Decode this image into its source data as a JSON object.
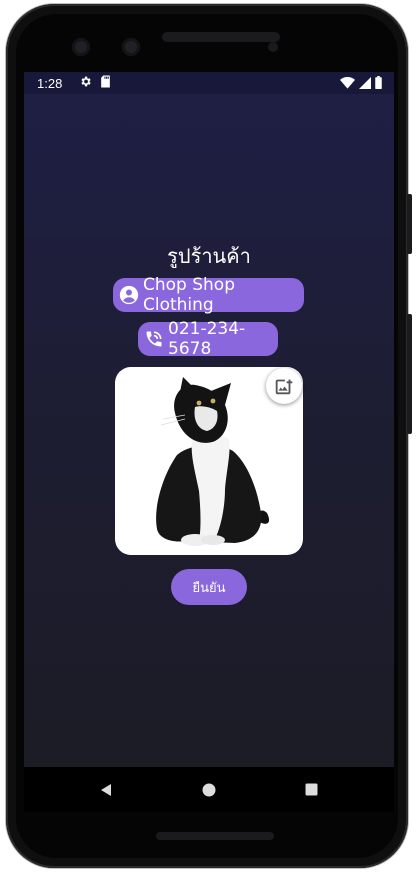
{
  "status_bar": {
    "time": "1:28",
    "left_icons": [
      "settings-icon",
      "sd-card-icon"
    ],
    "right_icons": [
      "wifi-icon",
      "signal-icon",
      "battery-icon"
    ]
  },
  "page": {
    "title": "รูปร้านค้า"
  },
  "shop": {
    "name": "Chop Shop Clothing",
    "name_icon": "account-circle-icon",
    "phone": "021-234-5678",
    "phone_icon": "phone-in-talk-icon"
  },
  "photo": {
    "content": "black-and-white cat",
    "add_icon": "add-photo-icon"
  },
  "actions": {
    "confirm_label": "ยืนยัน"
  },
  "nav": {
    "items": [
      "back-icon",
      "home-icon",
      "recents-icon"
    ]
  },
  "colors": {
    "accent": "#8b67dd",
    "background_top": "#1f1f46",
    "background_bottom": "#1c1c24",
    "text": "#ffffff"
  }
}
